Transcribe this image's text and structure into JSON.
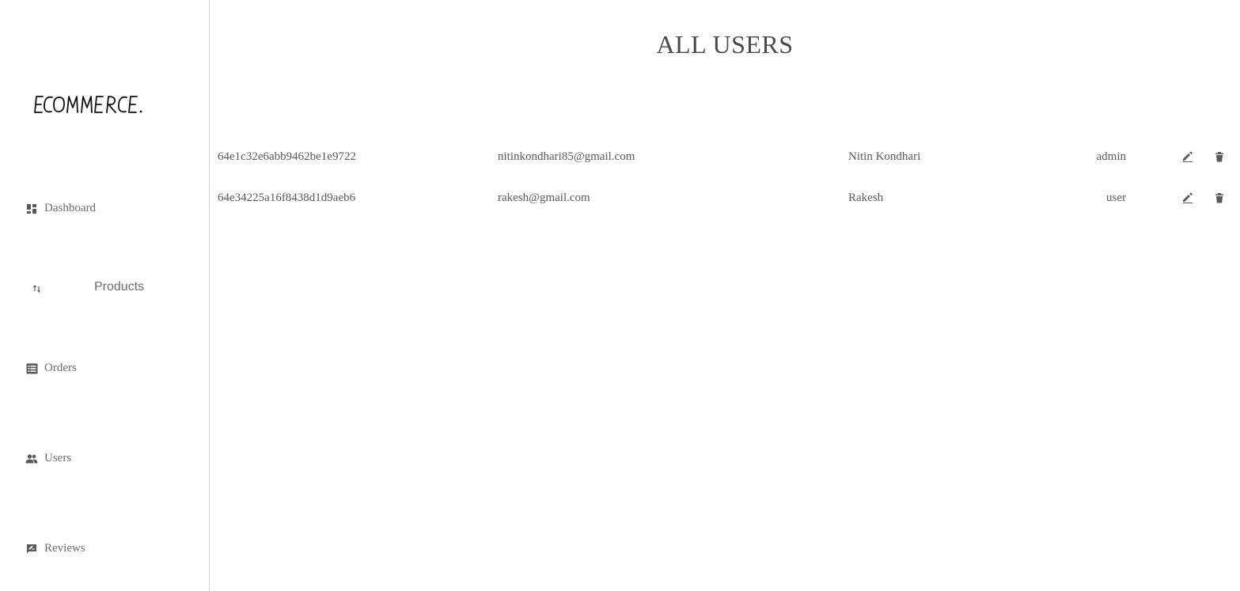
{
  "sidebar": {
    "logo_text": "ECOMMERCE.",
    "items": [
      {
        "label": "Dashboard",
        "icon": "dashboard-icon"
      },
      {
        "label": "Products",
        "icon": "import-export-icon"
      },
      {
        "label": "Orders",
        "icon": "list-alt-icon"
      },
      {
        "label": "Users",
        "icon": "people-icon"
      },
      {
        "label": "Reviews",
        "icon": "rate-review-icon"
      }
    ]
  },
  "main": {
    "title": "ALL USERS",
    "users": [
      {
        "id": "64e1c32e6abb9462be1e9722",
        "email": "nitinkondhari85@gmail.com",
        "name": "Nitin Kondhari",
        "role": "admin"
      },
      {
        "id": "64e34225a16f8438d1d9aeb6",
        "email": "rakesh@gmail.com",
        "name": "Rakesh",
        "role": "user"
      }
    ]
  },
  "colors": {
    "text": "#5a5a5a",
    "title": "#4a4a4a",
    "icon": "#5a5a5a",
    "divider": "#d9d9d9",
    "background": "#ffffff"
  }
}
